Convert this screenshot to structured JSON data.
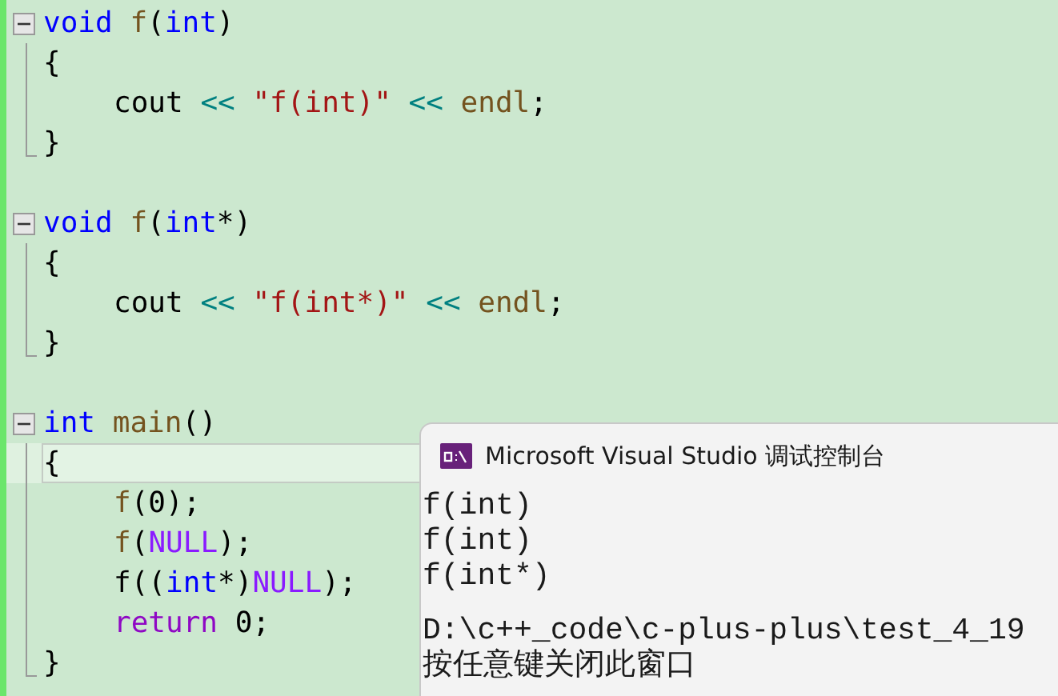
{
  "editor": {
    "lines": [
      {
        "kind": "fold",
        "current": false,
        "indented": false,
        "tokens": [
          {
            "kind": "kw",
            "text": "void"
          },
          {
            "kind": "fn",
            "text": " f"
          },
          {
            "kind": "plain",
            "text": "("
          },
          {
            "kind": "kw",
            "text": "int"
          },
          {
            "kind": "plain",
            "text": ")"
          }
        ]
      },
      {
        "kind": "body",
        "current": false,
        "indented": false,
        "tokens": [
          {
            "kind": "plain",
            "text": "{"
          }
        ]
      },
      {
        "kind": "body",
        "current": false,
        "indented": true,
        "tokens": [
          {
            "kind": "plain",
            "text": "cout"
          },
          {
            "kind": "op",
            "text": " << "
          },
          {
            "kind": "str",
            "text": "\"f(int)\""
          },
          {
            "kind": "op",
            "text": " << "
          },
          {
            "kind": "fn",
            "text": "endl"
          },
          {
            "kind": "plain",
            "text": ";"
          }
        ]
      },
      {
        "kind": "end",
        "current": false,
        "indented": false,
        "tokens": [
          {
            "kind": "plain",
            "text": "}"
          }
        ]
      },
      {
        "kind": "blank",
        "current": false
      },
      {
        "kind": "fold",
        "current": false,
        "indented": false,
        "tokens": [
          {
            "kind": "kw",
            "text": "void"
          },
          {
            "kind": "fn",
            "text": " f"
          },
          {
            "kind": "plain",
            "text": "("
          },
          {
            "kind": "kw",
            "text": "int"
          },
          {
            "kind": "plain",
            "text": "*)"
          }
        ]
      },
      {
        "kind": "body",
        "current": false,
        "indented": false,
        "tokens": [
          {
            "kind": "plain",
            "text": "{"
          }
        ]
      },
      {
        "kind": "body",
        "current": false,
        "indented": true,
        "tokens": [
          {
            "kind": "plain",
            "text": "cout"
          },
          {
            "kind": "op",
            "text": " << "
          },
          {
            "kind": "str",
            "text": "\"f(int*)\""
          },
          {
            "kind": "op",
            "text": " << "
          },
          {
            "kind": "fn",
            "text": "endl"
          },
          {
            "kind": "plain",
            "text": ";"
          }
        ]
      },
      {
        "kind": "end",
        "current": false,
        "indented": false,
        "tokens": [
          {
            "kind": "plain",
            "text": "}"
          }
        ]
      },
      {
        "kind": "blank",
        "current": false
      },
      {
        "kind": "fold",
        "current": false,
        "indented": false,
        "tokens": [
          {
            "kind": "kw",
            "text": "int"
          },
          {
            "kind": "fn",
            "text": " main"
          },
          {
            "kind": "plain",
            "text": "()"
          }
        ]
      },
      {
        "kind": "body",
        "current": true,
        "indented": false,
        "tokens": [
          {
            "kind": "plain",
            "text": "{"
          }
        ]
      },
      {
        "kind": "body",
        "current": false,
        "indented": true,
        "tokens": [
          {
            "kind": "fn",
            "text": "f"
          },
          {
            "kind": "plain",
            "text": "(0);"
          }
        ]
      },
      {
        "kind": "body",
        "current": false,
        "indented": true,
        "tokens": [
          {
            "kind": "fn",
            "text": "f"
          },
          {
            "kind": "plain",
            "text": "("
          },
          {
            "kind": "macro",
            "text": "NULL"
          },
          {
            "kind": "plain",
            "text": ");"
          }
        ]
      },
      {
        "kind": "body",
        "current": false,
        "indented": true,
        "tokens": [
          {
            "kind": "plain",
            "text": "f(("
          },
          {
            "kind": "kw",
            "text": "int"
          },
          {
            "kind": "plain",
            "text": "*)"
          },
          {
            "kind": "macro",
            "text": "NULL"
          },
          {
            "kind": "plain",
            "text": ");"
          }
        ]
      },
      {
        "kind": "body",
        "current": false,
        "indented": true,
        "tokens": [
          {
            "kind": "ctl",
            "text": "return"
          },
          {
            "kind": "plain",
            "text": " 0;"
          }
        ]
      },
      {
        "kind": "end",
        "current": false,
        "indented": false,
        "tokens": [
          {
            "kind": "plain",
            "text": "}"
          }
        ]
      }
    ]
  },
  "console": {
    "title": "Microsoft Visual Studio 调试控制台",
    "output": [
      "f(int)",
      "f(int)",
      "f(int*)"
    ],
    "footer": [
      "D:\\c++_code\\c-plus-plus\\test_4_19",
      "按任意键关闭此窗口"
    ]
  }
}
